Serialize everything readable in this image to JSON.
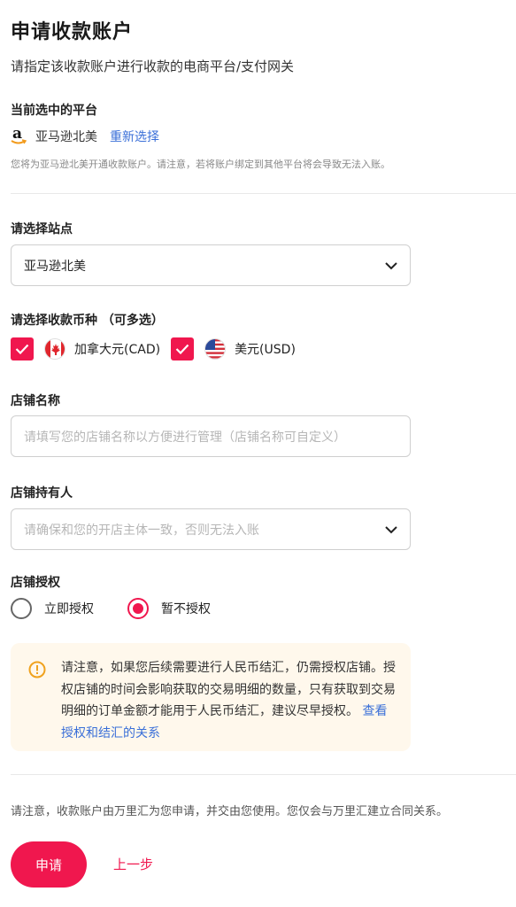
{
  "header": {
    "title": "申请收款账户",
    "subtitle": "请指定该收款账户进行收款的电商平台/支付网关"
  },
  "platform": {
    "section_label": "当前选中的平台",
    "icon": "amazon-logo",
    "name": "亚马逊北美",
    "reselect_label": "重新选择",
    "note": "您将为亚马逊北美开通收款账户。请注意，若将账户绑定到其他平台将会导致无法入账。"
  },
  "site": {
    "label": "请选择站点",
    "value": "亚马逊北美"
  },
  "currency": {
    "label": "请选择收款币种 （可多选）",
    "options": [
      {
        "label": "加拿大元(CAD)",
        "checked": true,
        "flag": "canada-flag"
      },
      {
        "label": "美元(USD)",
        "checked": true,
        "flag": "us-flag"
      }
    ]
  },
  "store_name": {
    "label": "店铺名称",
    "placeholder": "请填写您的店铺名称以方便进行管理（店铺名称可自定义）"
  },
  "store_owner": {
    "label": "店铺持有人",
    "placeholder": "请确保和您的开店主体一致，否则无法入账"
  },
  "authorization": {
    "label": "店铺授权",
    "options": [
      {
        "label": "立即授权",
        "selected": false
      },
      {
        "label": "暂不授权",
        "selected": true
      }
    ]
  },
  "warning": {
    "text": "请注意，如果您后续需要进行人民币结汇，仍需授权店铺。授权店铺的时间会影响获取的交易明细的数量，只有获取到交易明细的订单金额才能用于人民币结汇，建议尽早授权。",
    "link": "查看授权和结汇的关系"
  },
  "footer": {
    "note": "请注意，收款账户由万里汇为您申请，并交由您使用。您仅会与万里汇建立合同关系。",
    "apply_label": "申请",
    "back_label": "上一步"
  },
  "colors": {
    "accent": "#f0174e",
    "link": "#3a6fd8",
    "warning_bg": "#fff8ec",
    "warning_icon": "#f0a21e"
  }
}
